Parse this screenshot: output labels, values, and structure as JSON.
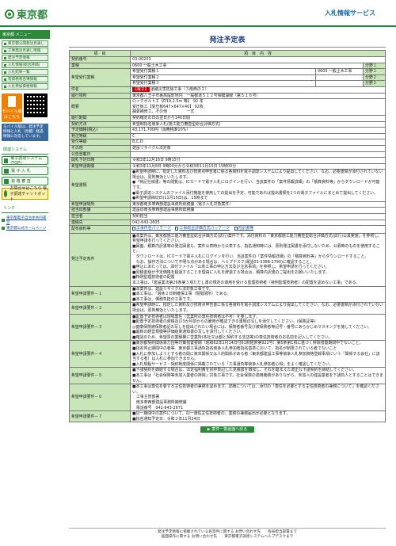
{
  "header": {
    "logo": "東京都",
    "title": "入札情報サービス"
  },
  "sidebar": {
    "section1": "東京都 メニュー",
    "menu": [
      "東京都公開発注見通し",
      "工事発注見通し情報",
      "発注予定情報",
      "入札情報(総合評価)",
      "入札結果一覧",
      "有資格者名簿情報",
      "入札参加資格情報"
    ],
    "mobile_label": "モバイル版",
    "mobile_sub": "はこちら",
    "side_note": "モバイル版は、発注予定情報と入札（見積）経過情報に対応しています。",
    "section2": "関連システム",
    "btns": [
      "電子調達システム(TOP)",
      "電 子 入 札",
      "資 格 審 査"
    ],
    "yellow_btn": "お問合せはこちら 電子調達チャットボット",
    "links_head": "リンク",
    "links": [
      "東京都電子自治体共同運営",
      "東京都公式ホームページ"
    ]
  },
  "main": {
    "title": "発注予定表",
    "col_item": "項　目",
    "col_content": "項　目　内　容",
    "rows": {
      "contract_no_label": "契約番号",
      "contract_no": "03-00203",
      "business_label": "業種",
      "business": "0600 一般土木工事",
      "b1": "分野１",
      "b2": "分野２",
      "b3": "分野３",
      "hope_label": "希望受付業種",
      "hope1": "希望受付業種１",
      "hope1v": "0600 一般土木工事",
      "hope2": "希望受付業種２",
      "hope3": "希望受付業種３",
      "h1a": "0600 一般土木工事",
      "h1b": "分野１",
      "h2b": "分野２",
      "h3b": "分野３",
      "work_label": "件名",
      "work_flag": "【電子】",
      "work": "道路災害防除工事（３南西の２）",
      "place_label": "履行場所",
      "place": "東京都八王子市裏高尾町地内　一般都道５１２号相模湖線（第５１６号）",
      "outline_label": "概要",
      "outline": "ロックボルト工【D19,2.5m 等】　92 本\n受圧板工【受圧板647×647×40】 92枚\n舗装補修工、その他　　　　　一式",
      "period_label": "履行期間",
      "period": "契約確定の日の翌日から146日間",
      "method_label": "契約方法",
      "method": "希望制指名競争入札(施工能力審査型総合評価方式)",
      "price_label": "予定価格(税込)",
      "price": "43,171,700円（消費税率10%）",
      "rank_label": "発注等級",
      "rank": "C",
      "accept_label": "受付等級",
      "accept": "B,C,D",
      "other_label": "その他",
      "other": "建設リサイクル法対象",
      "date_label": "公告登載日",
      "date": "",
      "open_label": "開札予定日時",
      "open": "令和3年12月16日 9時15分",
      "period2_label": "希望申請期間",
      "period2": "令和3年11月8日 9時00分から令和3年11月15日 15時00分",
      "req_label": "希望書類",
      "req": "●希望申請時に、指定した資料及び技術点申告書に係る各資料を電子調達システムにより提出してください。なお、必要書類が添付されていない場合は、原則無効といたします。\n●『特記仕様書』等の閲覧は、ICカードで電子入札にログインを行い、当該案件の「案件情報詳細」の「積算資料等」からダウンロードが可能です。\n●電子調達システムのファイル添付機能を使用しての提出を予定、可能であれば提出書類を1つの電子ファイルにまとめて提出してください。\n●希望申請締切日(11月15日)は、15時まで",
      "accept_place_label": "希望申請場所",
      "accept_place": "東京都南多摩西部建設事務所総務課（電子入札対象案件）",
      "dept_label": "担当局部課",
      "dept": "建設局南多摩西部建設事務所総務課",
      "person_label": "担当者",
      "person": "契約担当",
      "tel_label": "連絡先",
      "tel": "042-643-2605",
      "files_label": "配布資料等",
      "file1": "工事件名パッケージ",
      "file2": "工事総合評価方式パッケージ",
      "file3": "内訳書等",
      "notes_label": "発注予定条件",
      "notes": "■本案件は、東京都施工能力審査型総合評価方式(試行)案件です。添付資料の「東京都施工能力審査型総合評価方式(試行)公募実施」を参照し、希望申請を行ってください。\n■図面、積算内訳書等の発注図書も、案件公表時から公表する。指名通知時には、原則発注図書を添付しないため、公募時のものを使用すること。\n　ダウンロードは、ICカードで電子入札にログインを行い、当該案件の「案件情報詳細」の「積算資料等」からダウンロードすること。\n　なお、操作方法について不明な点がある場合は、ヘルプデスク(電話03-5388-2790)に確認すること。\n■申込にあたっては、添付ファイル「公表工事の申込方法及び注意事項」を参照し、希望申請を行ってください。\n■見積金額が予定価格を超過することを理由に入札を辞退する場合は、積算内訳書のご提出をお願いいたします。\n■特例監理技術者の配置\n本工事は、「建設業法第26条第３項ただし書の規定の適用を受ける監理技術者（特例監理技術者）の配置を認めない工事」である。",
      "r1_label": "希望申請要件－１",
      "r1": "■本案件は、建設リサイクル法対象工事です。\n■本工事は、「週休２日制確保工事（現場閉所）である。\n■本工事は、債務負担の工事です。",
      "r2_label": "希望申請要件－２",
      "r2": "■希望申請時に、指定した資料及び技術点申告書に係る各資料を電子調達システムにより提出してください。なお、必要書類が添付されていない場合は、原則無効といたします。",
      "r3_label": "希望申請要件－３",
      "r3": "■配置予定技術者は現場専任（営業所の専任技術者は不可）を要します。\n■配置予定技術者の資格及び3か月前からの雇用が確認できる書類の写しを添付してください。(保険証等)\n◎健康保険被保険者証の写しを提出されたい場合には、保険者番号及び被保険者等記号・番号にあらかじめマスキングを施してください。\n■最新の経営規模等評価結果通知書の写しを添付してください。\n■確認のため、希望票の業種欄に営業所(本社又は都と契約する支店等)の専任技術者のお名前を記入してください。",
      "r4_label": "希望申請要件－４",
      "r4": "■東京都契約関係暴力団等対策措置要綱（昭和62年1月14日付61財経庶第922号）第5条第1項に基づく排除措置期間中でないこと。\n■指名停止期間中の者等、東京都工事請負指名競争入札参加者指名基準において、指名が制限されている者でないこと\n■入札に参加しようとする者の間に資本関係又は人的関係がある者（東京都建設工事等競争入札参加資格登録事項にいう「関係する会社」に該当する者）は入札に参加できません。\n■入札規程サービス・契約制度関係に掲載されている「工事請負等競争入札参加者心得」をよく確認してください。",
      "r5_label": "希望申請要件－５",
      "r5": "■下請契約を締結する場合は、法定福利費を別枠表記した見積書を徴収し、それを踏まえた適正な下請契約を締結してください。\n■本工事は「社会保険等未加入業者の排除」対象工事です。社会保険の適用義務がありながら、未加入の建設業者を下請負人とすることはできません。",
      "r6_label": "希望申請要件－６",
      "r6": "■本工事は専任を要する主任技術者の兼務を認めます。詳細については、添付の「専任を必要とする主任技術者の兼務について」を確認ください。\n　工事主管部署\n　南多摩西部建設事務所補修課\n　電話番号　042-643-2671",
      "r7_label": "希望申請要件－７",
      "r7": "■同一期間中の案件について、同一選任主任技術者の、業務の兼務届出が必要となります。\n■指名通知予定日：令和３年11月24日"
    },
    "back": "案件一覧画面へ戻る"
  },
  "footer": {
    "line1": "発注予定情報に掲載されている各案件に関する お問い合わせ先　　各局担当部署まで",
    "line2": "画面操作に関する お問い合わせ先　　東京都電子調達システムヘルプデスクまで"
  }
}
